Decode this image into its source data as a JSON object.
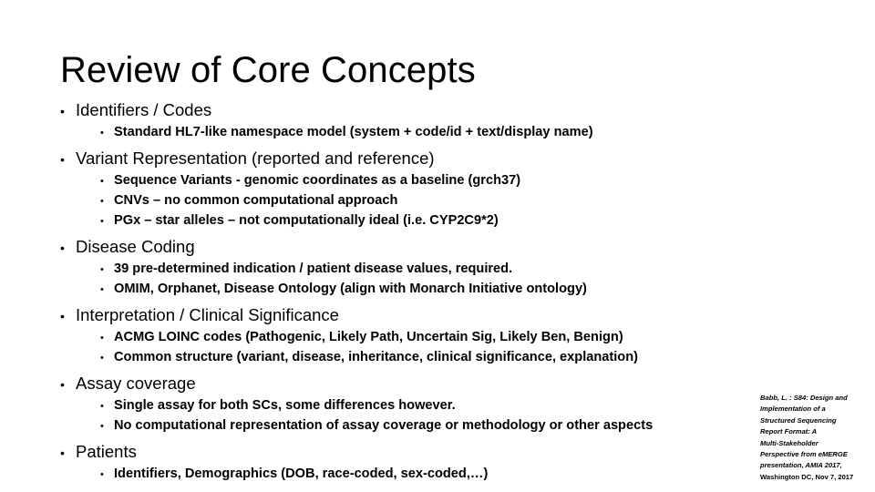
{
  "slide": {
    "title": "Review of Core Concepts",
    "bullet_glyph_level1": "•",
    "bullet_glyph_level2": "•",
    "groups": [
      {
        "heading": "Identifiers / Codes",
        "items": [
          "Standard HL7-like namespace model (system + code/id + text/display name)"
        ]
      },
      {
        "heading": "Variant Representation (reported and reference)",
        "items": [
          "Sequence Variants - genomic coordinates as a baseline (grch37)",
          "CNVs – no common computational approach",
          "PGx – star alleles – not computationally ideal (i.e. CYP2C9*2)"
        ]
      },
      {
        "heading": "Disease Coding",
        "items": [
          "39 pre-determined indication / patient disease values, required.",
          "OMIM, Orphanet, Disease Ontology (align with Monarch Initiative ontology)"
        ]
      },
      {
        "heading": "Interpretation / Clinical Significance",
        "items": [
          "ACMG LOINC codes (Pathogenic, Likely Path, Uncertain Sig, Likely Ben, Benign)",
          "Common structure (variant, disease, inheritance, clinical significance, explanation)"
        ]
      },
      {
        "heading": "Assay coverage",
        "items": [
          "Single assay for both SCs, some differences however.",
          "No computational representation of assay coverage or methodology or other aspects"
        ]
      },
      {
        "heading": "Patients",
        "items": [
          "Identifiers, Demographics (DOB, race-coded, sex-coded,…)"
        ]
      }
    ]
  },
  "citation": {
    "lines": [
      "Babb, L. : S84: Design and",
      "Implementation of a",
      "Structured Sequencing",
      "Report Format: A",
      "Multi-Stakeholder",
      "Perspective from eMERGE",
      "presentation, AMIA 2017,",
      "Washington DC, Nov 7, 2017"
    ]
  },
  "colors": {
    "background": "#ffffff",
    "text": "#000000"
  }
}
